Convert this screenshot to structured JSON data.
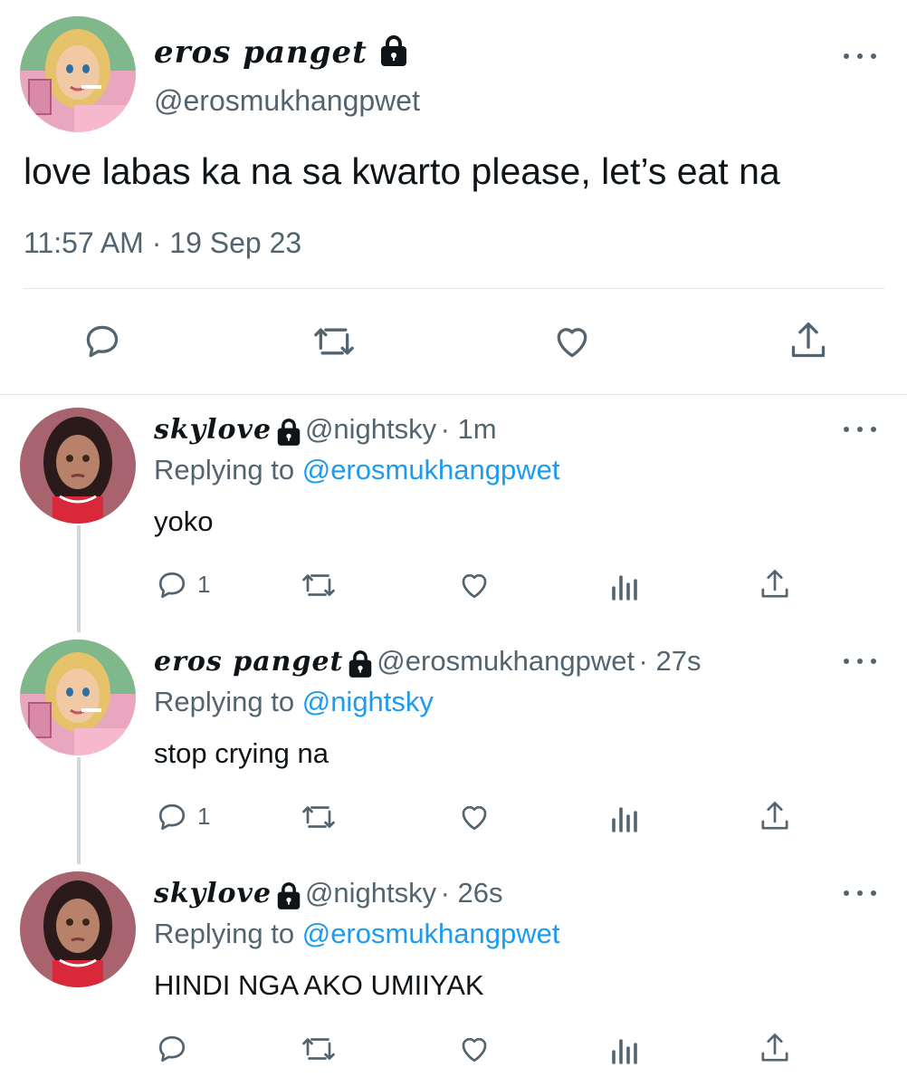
{
  "main_tweet": {
    "display_name": "eros panget",
    "handle": "@erosmukhangpwet",
    "text": "love labas ka na sa kwarto please, let’s eat na",
    "timestamp": "11:57 AM · 19 Sep 23",
    "actions": [
      "reply-icon",
      "retweet-icon",
      "like-icon",
      "share-icon"
    ]
  },
  "replies": [
    {
      "display_name": "skylove",
      "handle": "@nightsky",
      "time": "· 1m",
      "replying_label": "Replying to",
      "replying_to": "@erosmukhangpwet",
      "text": "yoko",
      "reply_count": "1"
    },
    {
      "display_name": "eros panget",
      "handle": "@erosmukhangpwet",
      "time": "· 27s",
      "replying_label": "Replying to",
      "replying_to": "@nightsky",
      "text": "stop crying na",
      "reply_count": "1"
    },
    {
      "display_name": "skylove",
      "handle": "@nightsky",
      "time": "· 26s",
      "replying_label": "Replying to",
      "replying_to": "@erosmukhangpwet",
      "text": "HINDI NGA AKO UMIIYAK",
      "reply_count": ""
    }
  ],
  "colors": {
    "text": "#0f1419",
    "secondary": "#536471",
    "link": "#1d9bf0",
    "divider": "#e1e8ed",
    "thread_line": "#cfd9de"
  }
}
